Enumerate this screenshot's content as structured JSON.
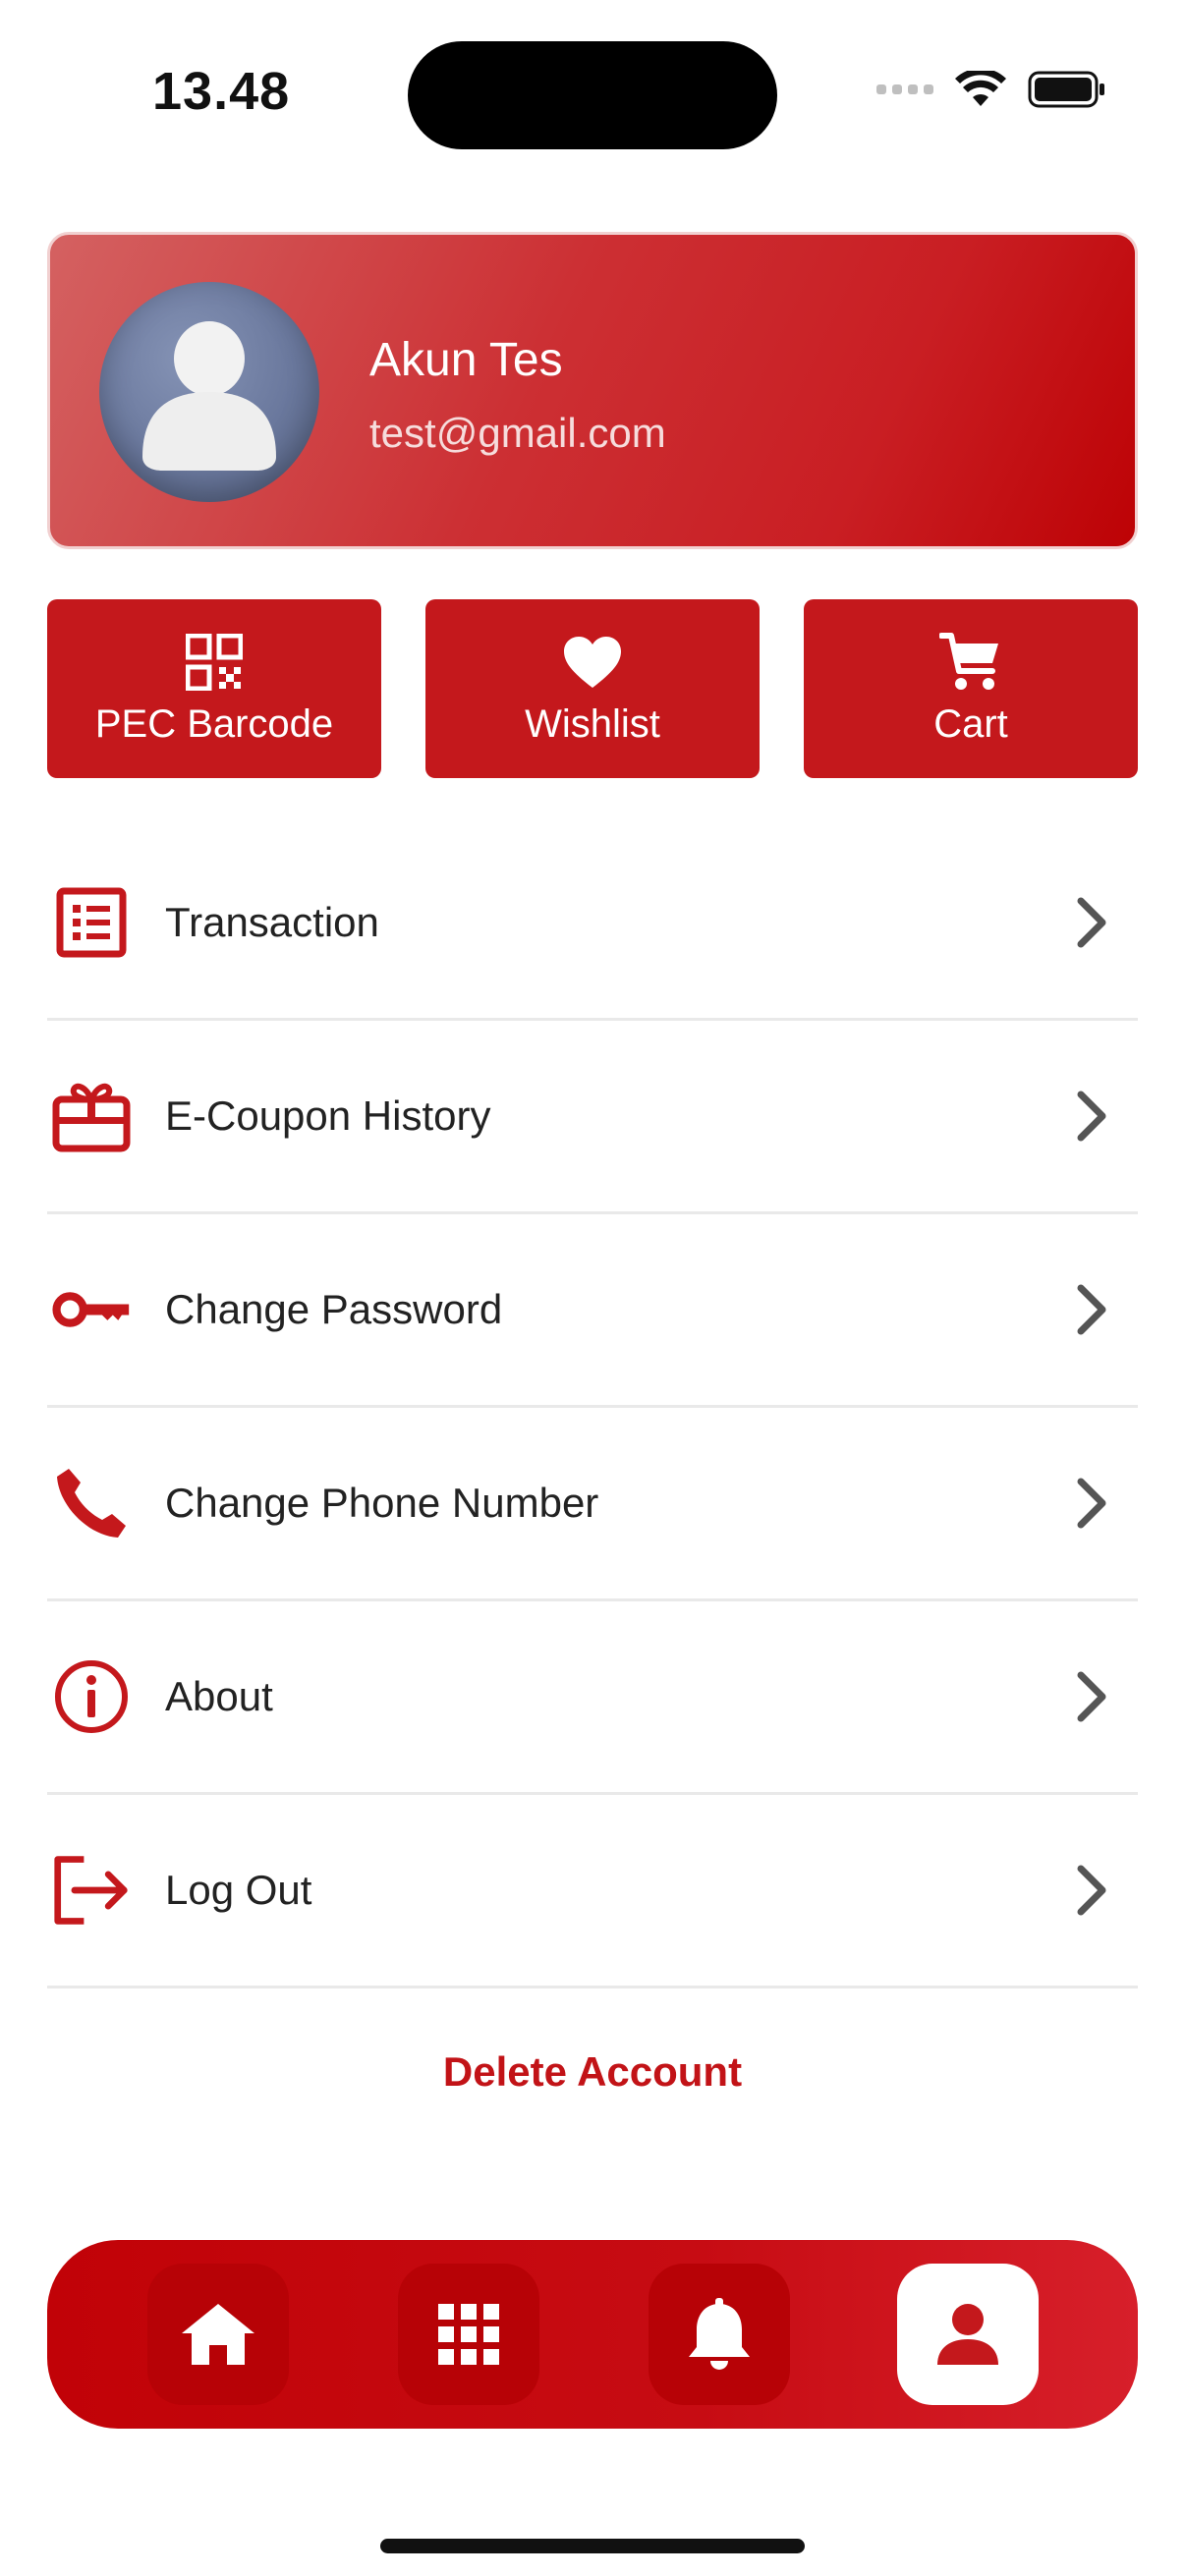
{
  "status_bar": {
    "time": "13.48"
  },
  "profile": {
    "name": "Akun Tes",
    "email": "test@gmail.com"
  },
  "quick_actions": [
    {
      "label": "PEC Barcode",
      "icon": "qr-code-icon"
    },
    {
      "label": "Wishlist",
      "icon": "heart-icon"
    },
    {
      "label": "Cart",
      "icon": "cart-icon"
    }
  ],
  "menu": [
    {
      "label": "Transaction",
      "icon": "receipt-list-icon"
    },
    {
      "label": "E-Coupon History",
      "icon": "gift-card-icon"
    },
    {
      "label": "Change Password",
      "icon": "key-icon"
    },
    {
      "label": "Change Phone Number",
      "icon": "phone-icon"
    },
    {
      "label": "About",
      "icon": "info-icon"
    },
    {
      "label": "Log Out",
      "icon": "logout-icon"
    }
  ],
  "delete_account_label": "Delete Account",
  "bottom_nav": [
    {
      "icon": "home-icon",
      "active": false
    },
    {
      "icon": "grid-icon",
      "active": false
    },
    {
      "icon": "bell-icon",
      "active": false
    },
    {
      "icon": "profile-icon",
      "active": true
    }
  ],
  "colors": {
    "primary": "#C4181C",
    "accent_text": "#C21317",
    "nav_active_bg": "#FFFFFF"
  }
}
